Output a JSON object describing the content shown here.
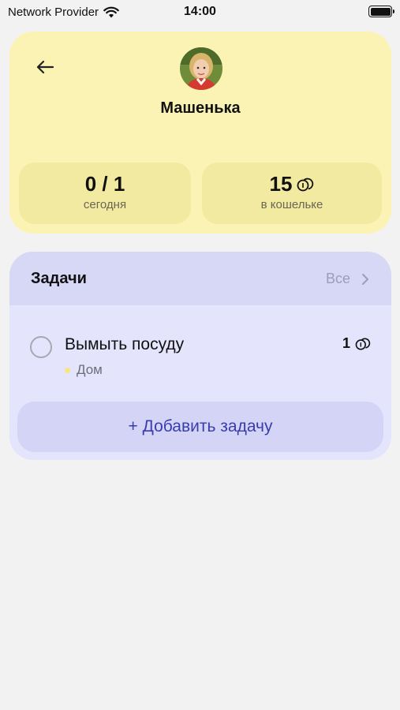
{
  "status_bar": {
    "carrier": "Network Provider",
    "time": "14:00"
  },
  "profile": {
    "name": "Машенька",
    "stats": {
      "today_value": "0 / 1",
      "today_label": "сегодня",
      "wallet_value": "15",
      "wallet_label": "в кошельке"
    }
  },
  "tasks": {
    "title": "Задачи",
    "see_all": "Все",
    "items": [
      {
        "title": "Вымыть посуду",
        "category": "Дом",
        "reward": "1"
      }
    ],
    "add_label": "+ Добавить задачу"
  },
  "colors": {
    "profile_bg": "#faf3b4",
    "tasks_bg": "#e4e4fc",
    "accent": "#3a3cae",
    "category_dot": "#f4e87a"
  },
  "icons": [
    "wifi-icon",
    "battery-icon",
    "back-arrow-icon",
    "coin-icon",
    "chevron-right-icon"
  ]
}
